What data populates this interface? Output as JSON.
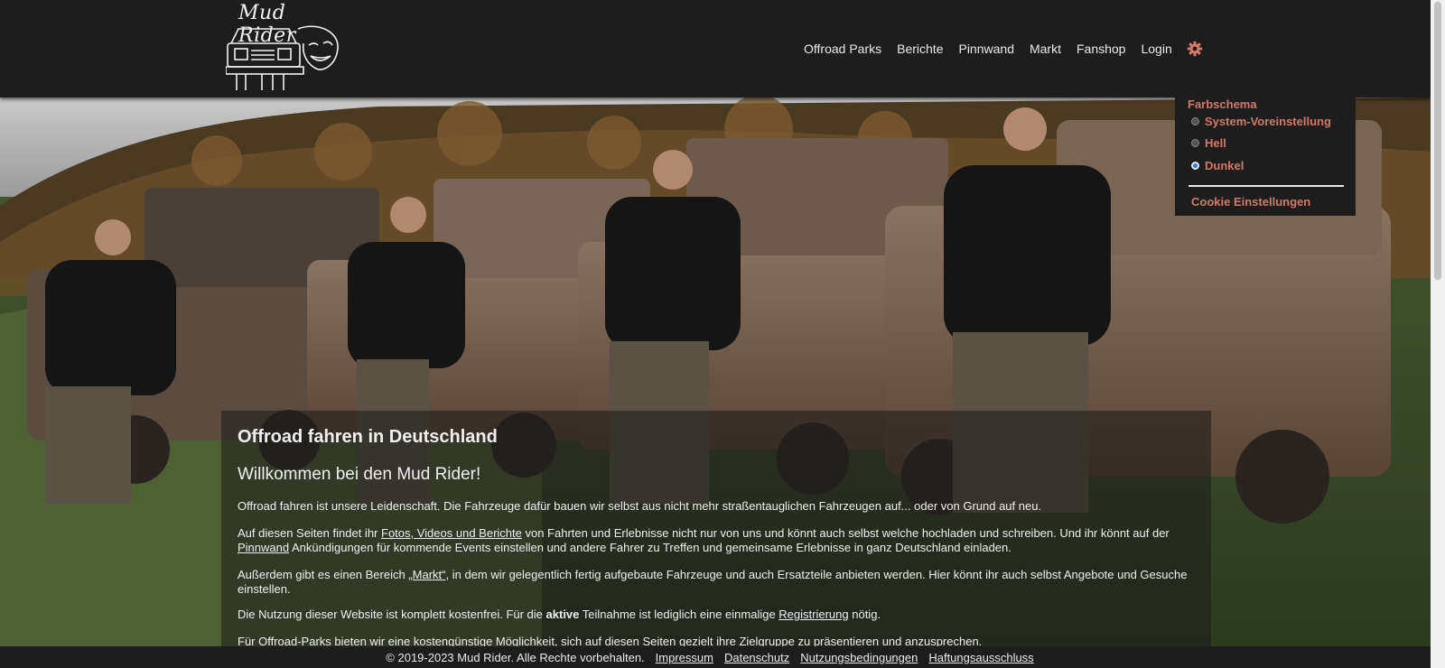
{
  "brand": {
    "logo_text": "Mud Rider"
  },
  "nav": {
    "items": [
      "Offroad Parks",
      "Berichte",
      "Pinnwand",
      "Markt",
      "Fanshop",
      "Login"
    ],
    "settings_icon": "gear-icon"
  },
  "theme_menu": {
    "title": "Farbschema",
    "options": [
      {
        "label": "System-Voreinstellung",
        "checked": false
      },
      {
        "label": "Hell",
        "checked": false
      },
      {
        "label": "Dunkel",
        "checked": true
      }
    ],
    "cookie_label": "Cookie Einstellungen",
    "accent_color": "#d4796a"
  },
  "content": {
    "title": "Offroad fahren in Deutschland",
    "subtitle": "Willkommen bei den Mud Rider!",
    "p1": "Offroad fahren ist unsere Leidenschaft. Die Fahrzeuge dafür bauen wir selbst aus nicht mehr straßentauglichen Fahrzeugen auf... oder von Grund auf neu.",
    "p2_pre": "Auf diesen Seiten findet ihr ",
    "p2_link1": "Fotos, Videos und Berichte",
    "p2_mid": " von Fahrten und Erlebnisse nicht nur von uns und könnt auch selbst welche hochladen und schreiben. Und ihr könnt auf der ",
    "p2_link2": "Pinnwand",
    "p2_post": " Ankündigungen für kommende Events einstellen und andere Fahrer zu Treffen und gemeinsame Erlebnisse in ganz Deutschland einladen.",
    "p3_pre": "Außerdem gibt es einen Bereich ",
    "p3_link": "„Markt“",
    "p3_post": ", in dem wir gelegentlich fertig aufgebaute Fahrzeuge und auch Ersatzteile anbieten werden. Hier könnt ihr auch selbst Angebote und Gesuche einstellen.",
    "p4_pre": "Die Nutzung dieser Website ist komplett kostenfrei. Für die ",
    "p4_bold": "aktive",
    "p4_mid": " Teilnahme ist lediglich eine einmalige ",
    "p4_link": "Registrierung",
    "p4_post": " nötig.",
    "p5": "Für Offroad-Parks bieten wir eine kostengünstige Möglichkeit, sich auf diesen Seiten gezielt ihre Zielgruppe zu präsentieren und anzusprechen."
  },
  "footer": {
    "copyright": "© 2019-2023 Mud Rider. Alle Rechte vorbehalten.",
    "links": [
      "Impressum",
      "Datenschutz",
      "Nutzungsbedingungen",
      "Haftungsausschluss"
    ]
  }
}
